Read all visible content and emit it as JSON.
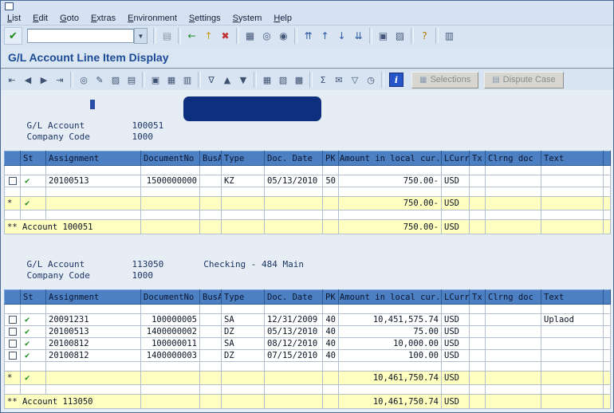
{
  "title": "G/L Account Line Item Display",
  "menu_bar": {
    "items": [
      "List",
      "Edit",
      "Goto",
      "Extras",
      "Environment",
      "Settings",
      "System",
      "Help"
    ]
  },
  "toolbar": {
    "enter_icon": {
      "name": "enter-icon",
      "glyph": "✔"
    },
    "command_field": {
      "value": "",
      "dropdown_glyph": "▼"
    },
    "groups": [
      [
        {
          "name": "save-icon",
          "glyph": "▤",
          "color": "#8a96a6"
        }
      ],
      [
        {
          "name": "back-icon",
          "glyph": "←",
          "color": "#1e8a1e"
        },
        {
          "name": "exit-icon",
          "glyph": "↑",
          "color": "#c89a10"
        },
        {
          "name": "cancel-icon",
          "glyph": "✖",
          "color": "#c03030"
        }
      ],
      [
        {
          "name": "print-icon",
          "glyph": "▦",
          "color": "#44587a"
        },
        {
          "name": "find-icon",
          "glyph": "◎",
          "color": "#44587a"
        },
        {
          "name": "find-next-icon",
          "glyph": "◉",
          "color": "#44587a"
        }
      ],
      [
        {
          "name": "first-page-icon",
          "glyph": "⇈",
          "color": "#2a5aa0"
        },
        {
          "name": "page-up-icon",
          "glyph": "↑",
          "color": "#2a5aa0"
        },
        {
          "name": "page-down-icon",
          "glyph": "↓",
          "color": "#2a5aa0"
        },
        {
          "name": "last-page-icon",
          "glyph": "⇊",
          "color": "#2a5aa0"
        }
      ],
      [
        {
          "name": "new-session-icon",
          "glyph": "▣",
          "color": "#44587a"
        },
        {
          "name": "create-shortcut-icon",
          "glyph": "▨",
          "color": "#44587a"
        }
      ],
      [
        {
          "name": "help-icon",
          "glyph": "?",
          "color": "#b07800"
        }
      ],
      [
        {
          "name": "customize-layout-icon",
          "glyph": "▥",
          "color": "#44587a"
        }
      ]
    ]
  },
  "app_toolbar": {
    "groups": [
      [
        {
          "name": "first-item-icon",
          "glyph": "⇤"
        },
        {
          "name": "previous-item-icon",
          "glyph": "◀"
        },
        {
          "name": "next-item-icon",
          "glyph": "▶"
        },
        {
          "name": "last-item-icon",
          "glyph": "⇥"
        }
      ],
      [
        {
          "name": "details-icon",
          "glyph": "◎"
        },
        {
          "name": "change-icon",
          "glyph": "✎"
        },
        {
          "name": "block-item-icon",
          "glyph": "▨"
        },
        {
          "name": "additional-data-icon",
          "glyph": "▤"
        }
      ],
      [
        {
          "name": "copy-icon",
          "glyph": "▣"
        },
        {
          "name": "select-all-icon",
          "glyph": "▦"
        },
        {
          "name": "document-icon",
          "glyph": "▥"
        }
      ],
      [
        {
          "name": "filter-icon",
          "glyph": "∇"
        },
        {
          "name": "sort-ascending-icon",
          "glyph": "▲"
        },
        {
          "name": "sort-descending-icon",
          "glyph": "▼"
        }
      ],
      [
        {
          "name": "display-grid-icon",
          "glyph": "▦"
        },
        {
          "name": "spreadsheet-icon",
          "glyph": "▧"
        },
        {
          "name": "word-processing-icon",
          "glyph": "▩"
        }
      ],
      [
        {
          "name": "sum-icon",
          "glyph": "Σ"
        },
        {
          "name": "mail-icon",
          "glyph": "✉"
        },
        {
          "name": "export-icon",
          "glyph": "▽"
        },
        {
          "name": "worklist-icon",
          "glyph": "◷"
        }
      ],
      [
        {
          "name": "info-icon",
          "glyph": "i"
        }
      ]
    ],
    "buttons": [
      {
        "name": "selections-button",
        "label": "Selections",
        "icon_glyph": "▦",
        "enabled": false
      },
      {
        "name": "dispute-case-button",
        "label": "Dispute Case",
        "icon_glyph": "▤",
        "enabled": false
      }
    ]
  },
  "icons": {
    "green_check": "✔"
  },
  "section1": {
    "gl_account_label": "G/L Account",
    "gl_account": "100051",
    "company_code_label": "Company Code",
    "company_code": "1000"
  },
  "columns": [
    "St",
    "Assignment",
    "DocumentNo",
    "BusA",
    "Type",
    "Doc. Date",
    "PK",
    "Amount in local cur.",
    "LCurr",
    "Tx",
    "Clrng doc",
    "Text"
  ],
  "table1": {
    "rows": [
      {
        "assignment": "20100513",
        "document_no": "1500000000",
        "busa": "",
        "type": "KZ",
        "doc_date": "05/13/2010",
        "pk": "50",
        "amount": "750.00-",
        "lcurr": "USD",
        "tx": "",
        "clrng_doc": "",
        "text": ""
      }
    ],
    "subtotal": {
      "marker": "*",
      "amount": "750.00-",
      "lcurr": "USD"
    },
    "total": {
      "label": "** Account 100051",
      "amount": "750.00-",
      "lcurr": "USD"
    }
  },
  "section2": {
    "gl_account_label": "G/L Account",
    "gl_account": "113050",
    "account_name": "Checking - 484 Main",
    "company_code_label": "Company Code",
    "company_code": "1000"
  },
  "table2": {
    "rows": [
      {
        "assignment": "20091231",
        "document_no": "100000005",
        "busa": "",
        "type": "SA",
        "doc_date": "12/31/2009",
        "pk": "40",
        "amount": "10,451,575.74",
        "lcurr": "USD",
        "tx": "",
        "clrng_doc": "",
        "text": "Uplaod"
      },
      {
        "assignment": "20100513",
        "document_no": "1400000002",
        "busa": "",
        "type": "DZ",
        "doc_date": "05/13/2010",
        "pk": "40",
        "amount": "75.00",
        "lcurr": "USD",
        "tx": "",
        "clrng_doc": "",
        "text": ""
      },
      {
        "assignment": "20100812",
        "document_no": "100000011",
        "busa": "",
        "type": "SA",
        "doc_date": "08/12/2010",
        "pk": "40",
        "amount": "10,000.00",
        "lcurr": "USD",
        "tx": "",
        "clrng_doc": "",
        "text": ""
      },
      {
        "assignment": "20100812",
        "document_no": "1400000003",
        "busa": "",
        "type": "DZ",
        "doc_date": "07/15/2010",
        "pk": "40",
        "amount": "100.00",
        "lcurr": "USD",
        "tx": "",
        "clrng_doc": "",
        "text": ""
      }
    ],
    "subtotal": {
      "marker": "*",
      "amount": "10,461,750.74",
      "lcurr": "USD"
    },
    "total": {
      "label": "** Account 113050",
      "amount": "10,461,750.74",
      "lcurr": "USD"
    }
  },
  "colors": {
    "table_header_blue": "#4d7fc3",
    "sum_row_yellow": "#ffffc2",
    "check_green": "#1a8f1a",
    "title_blue": "#1b4a96",
    "redaction_navy": "#0d2f7d"
  }
}
